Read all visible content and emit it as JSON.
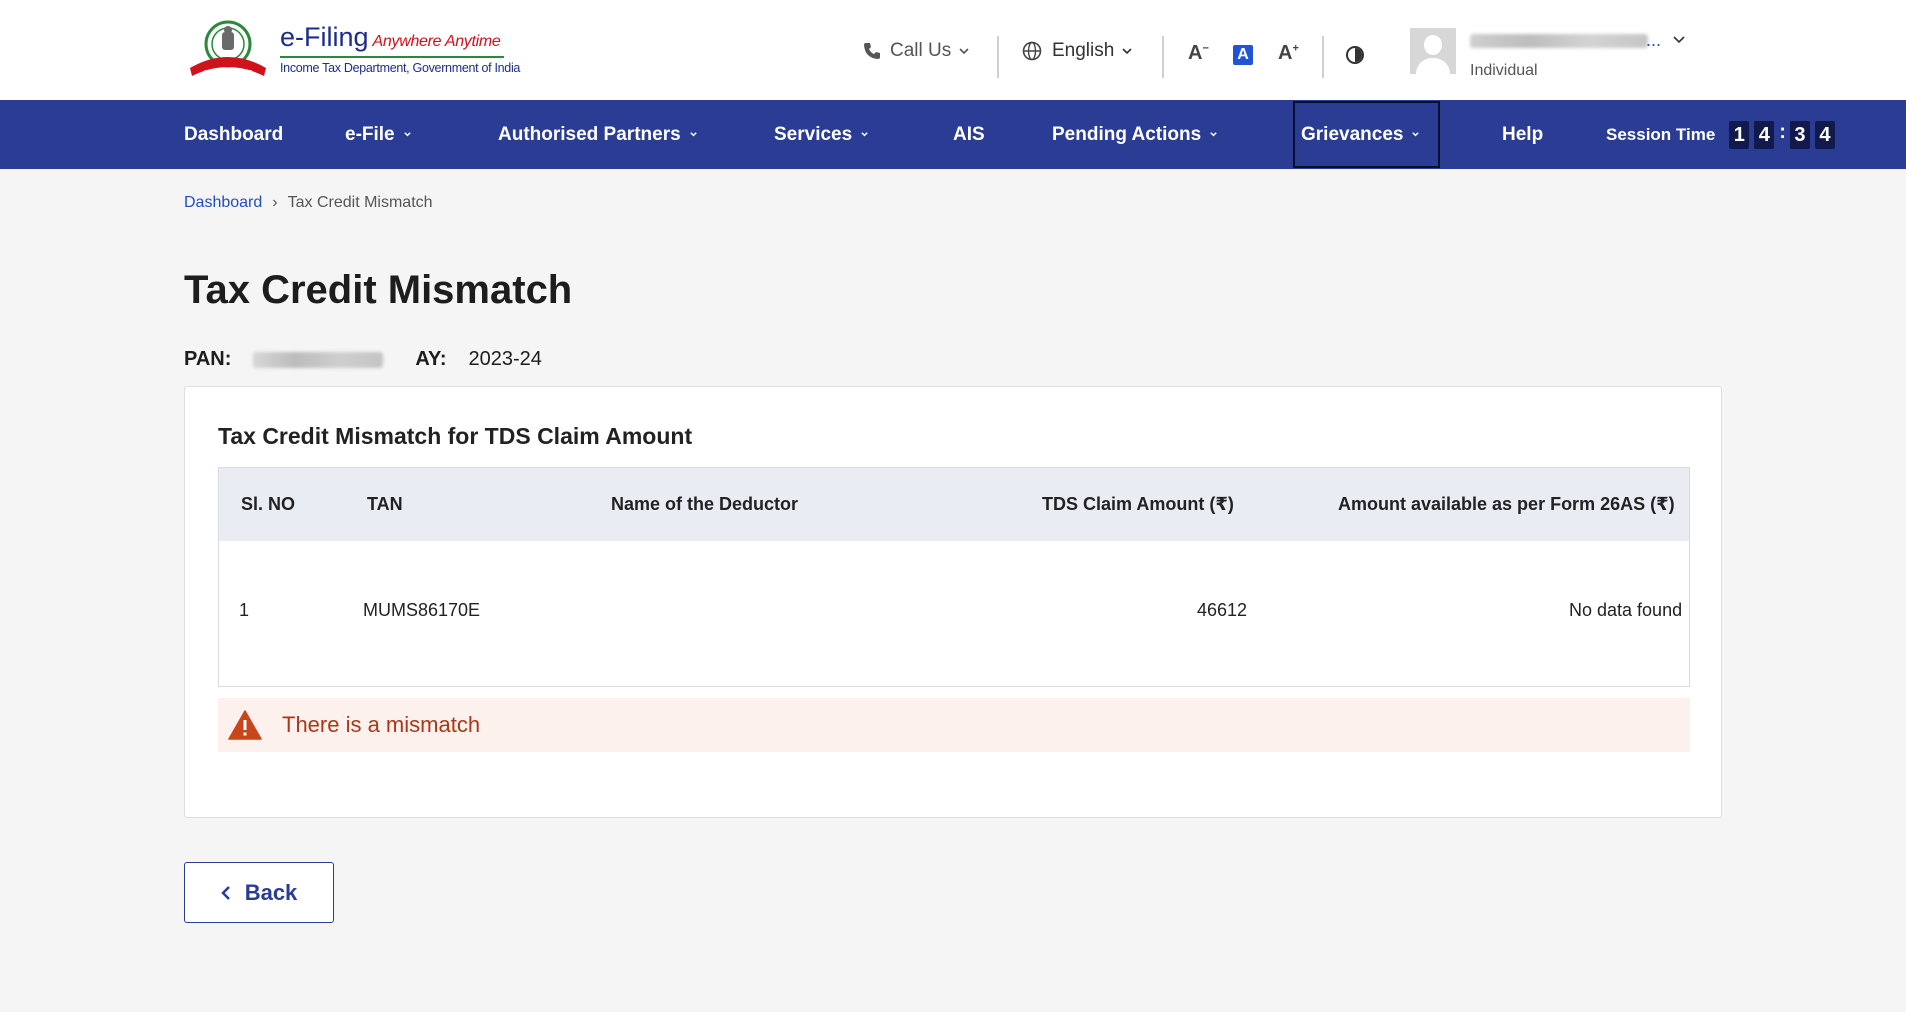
{
  "header": {
    "brand_name": "e-Filing",
    "brand_tagline": "Anywhere Anytime",
    "brand_sub": "Income Tax Department, Government of India",
    "call_us": "Call Us",
    "language": "English",
    "font_decrease": "A",
    "font_default": "A",
    "font_increase": "A",
    "user_role": "Individual",
    "username_ellipsis": "..."
  },
  "nav": {
    "items": [
      {
        "label": "Dashboard"
      },
      {
        "label": "e-File"
      },
      {
        "label": "Authorised Partners"
      },
      {
        "label": "Services"
      },
      {
        "label": "AIS"
      },
      {
        "label": "Pending Actions"
      },
      {
        "label": "Grievances"
      },
      {
        "label": "Help"
      }
    ],
    "session_label": "Session Time",
    "session_digits": [
      "1",
      "4",
      "3",
      "4"
    ]
  },
  "breadcrumb": {
    "home": "Dashboard",
    "current": "Tax Credit Mismatch"
  },
  "page": {
    "title": "Tax Credit Mismatch",
    "pan_label": "PAN:",
    "ay_label": "AY:",
    "ay_value": "2023-24"
  },
  "card": {
    "title": "Tax Credit Mismatch for TDS Claim Amount",
    "columns": [
      "Sl. NO",
      "TAN",
      "Name of the Deductor",
      "TDS Claim Amount (₹)",
      "Amount available as per Form 26AS (₹)"
    ],
    "rows": [
      {
        "sl": "1",
        "tan": "MUMS86170E",
        "deductor": "",
        "claim": "46612",
        "available": "No data found"
      }
    ],
    "alert": "There is a mismatch"
  },
  "actions": {
    "back": "Back"
  },
  "colors": {
    "nav_bg": "#2a3c93",
    "link": "#1f4fbf",
    "alert_bg": "#fdf1ee",
    "alert_text": "#a8381a",
    "warning_icon": "#c8461b"
  }
}
